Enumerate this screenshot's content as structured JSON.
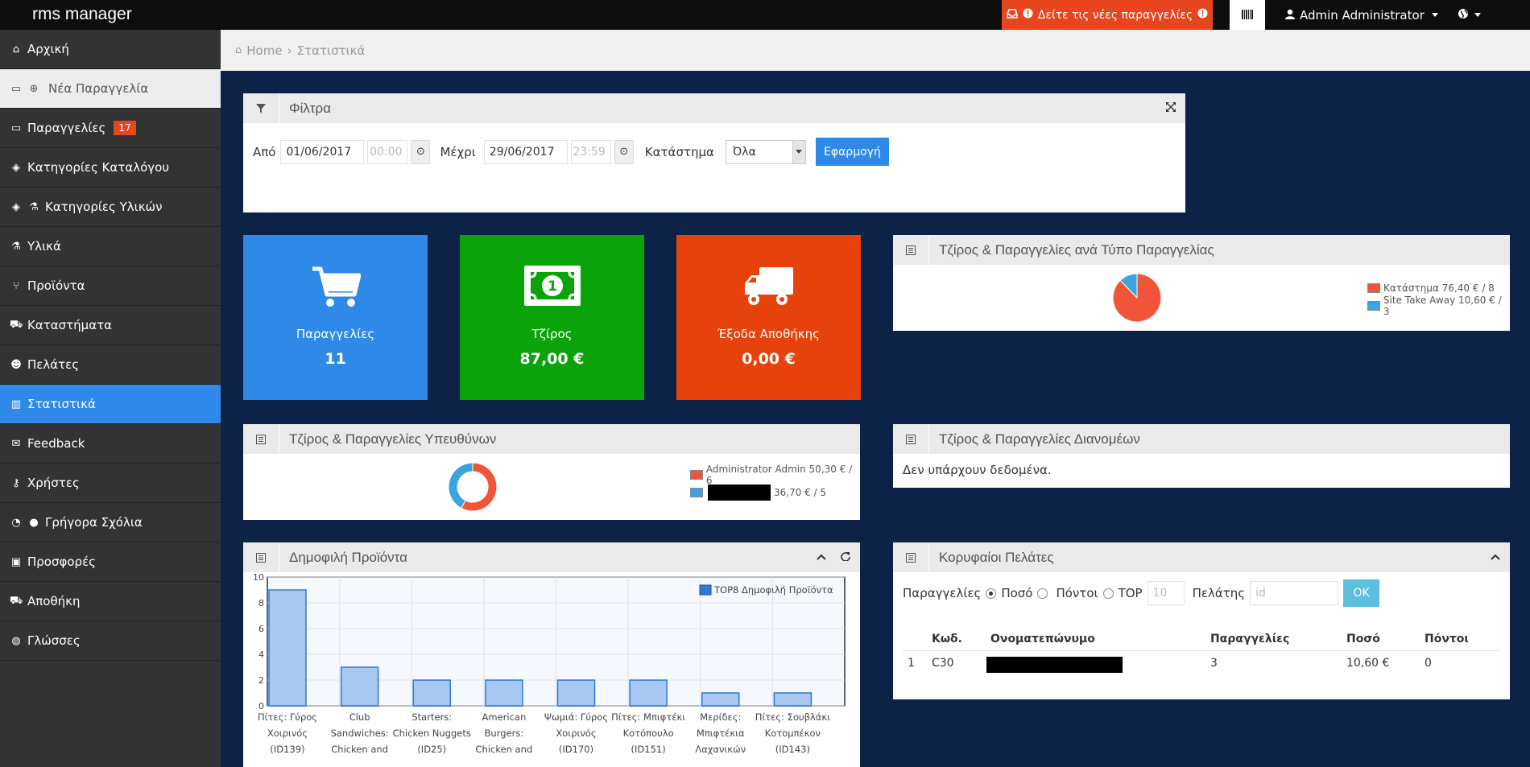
{
  "app": {
    "brand": "rms manager"
  },
  "topbar": {
    "alert_label": "Δείτε τις νέες παραγγελίες",
    "user_label": "Admin Administrator"
  },
  "sidebar": {
    "items": [
      {
        "label": "Αρχική",
        "icon": "home-icon"
      },
      {
        "label": "Νέα Παραγγελία",
        "icon": "inbox-plus-icon"
      },
      {
        "label": "Παραγγελίες",
        "icon": "inbox-icon",
        "badge": "17"
      },
      {
        "label": "Κατηγορίες Καταλόγου",
        "icon": "tags-icon"
      },
      {
        "label": "Κατηγορίες Υλικών",
        "icon": "tags-flask-icon"
      },
      {
        "label": "Υλικά",
        "icon": "flask-icon"
      },
      {
        "label": "Προϊόντα",
        "icon": "cutlery-icon"
      },
      {
        "label": "Καταστήματα",
        "icon": "cart-icon"
      },
      {
        "label": "Πελάτες",
        "icon": "users-icon"
      },
      {
        "label": "Στατιστικά",
        "icon": "bar-chart-icon"
      },
      {
        "label": "Feedback",
        "icon": "comments-icon"
      },
      {
        "label": "Χρήστες",
        "icon": "key-icon"
      },
      {
        "label": "Γρήγορα Σχόλια",
        "icon": "dashboard-comment-icon"
      },
      {
        "label": "Προσφορές",
        "icon": "gift-icon"
      },
      {
        "label": "Αποθήκη",
        "icon": "truck-icon"
      },
      {
        "label": "Γλώσσες",
        "icon": "globe-icon"
      }
    ],
    "active": "Στατιστικά"
  },
  "breadcrumb": {
    "home": "Home",
    "current": "Στατιστικά"
  },
  "filters": {
    "title": "Φίλτρα",
    "from_label": "Από",
    "from_date": "01/06/2017",
    "from_time": "00:00",
    "to_label": "Μέχρι",
    "to_date": "29/06/2017",
    "to_time": "23:59",
    "store_label": "Κατάστημα",
    "store_value": "Όλα",
    "apply_label": "Εφαρμογή"
  },
  "tiles": [
    {
      "label": "Παραγγελίες",
      "value": "11",
      "color": "#2e89e8",
      "icon": "cart-icon"
    },
    {
      "label": "Τζίρος",
      "value": "87,00 €",
      "color": "#0aa30a",
      "icon": "money-icon"
    },
    {
      "label": "Έξοδα Αποθήκης",
      "value": "0,00 €",
      "color": "#e8420c",
      "icon": "truck-icon"
    }
  ],
  "order_type_panel": {
    "title": "Τζίρος & Παραγγελίες ανά Τύπο Παραγγελίας",
    "legend": [
      {
        "label": "Κατάστημα 76,40 € / 8",
        "color": "#f0553a",
        "value": 76.4
      },
      {
        "label": "Site Take Away 10,60 € / 3",
        "color": "#3ba3e0",
        "value": 10.6
      }
    ]
  },
  "managers_panel": {
    "title": "Τζίρος & Παραγγελίες Υπευθύνων",
    "legend": [
      {
        "label": "Administrator Admin 50,30 € / 6",
        "color": "#f0553a",
        "value": 50.3
      },
      {
        "label": "36,70 € / 5",
        "color": "#3ba3e0",
        "value": 36.7
      }
    ]
  },
  "delivery_panel": {
    "title": "Τζίρος & Παραγγελίες Διανομέων",
    "empty_text": "Δεν υπάρχουν δεδομένα."
  },
  "popular_panel": {
    "title": "Δημοφιλή Προϊόντα"
  },
  "chart_data": {
    "type": "bar",
    "categories": [
      "Πίτες: Γύρος Χοιρινός (ID139)",
      "Club Sandwiches: Chicken and",
      "Starters: Chicken Nuggets (ID25)",
      "American Burgers: Chicken and Bacon",
      "Ψωμιά: Γύρος Χοιρινός (ID170)",
      "Πίτες: Μπιφτέκι Κοτόπουλο (ID151)",
      "Μερίδες: Μπιφτέκια Λαχανικών",
      "Πίτες: Σουβλάκι Κοτομπέκον (ID143)"
    ],
    "series": [
      {
        "name": "TOP8 Δημοφιλή Προϊόντα",
        "values": [
          9,
          3,
          2,
          2,
          2,
          2,
          1,
          1
        ]
      }
    ],
    "ylim": [
      0,
      10
    ],
    "yticks": [
      "0",
      "2",
      "4",
      "6",
      "8",
      "10"
    ],
    "grid": true,
    "legend": "top-right",
    "colors": {
      "fill": "#a8c8f2",
      "stroke": "#2e78d6"
    }
  },
  "top_customers_panel": {
    "title": "Κορυφαίοι Πελάτες",
    "orders_label": "Παραγγελίες",
    "amount_label": "Ποσό",
    "points_label": "Πόντοι",
    "top_label": "TOP",
    "top_placeholder": "10",
    "customer_label": "Πελάτης",
    "customer_placeholder": "id",
    "ok_label": "OK",
    "columns": [
      "Κωδ.",
      "Ονοματεπώνυμο",
      "Παραγγελίες",
      "Ποσό",
      "Πόντοι"
    ],
    "rows": [
      {
        "index": "1",
        "code": "C30",
        "orders": "3",
        "amount": "10,60 €",
        "points": "0"
      }
    ]
  }
}
